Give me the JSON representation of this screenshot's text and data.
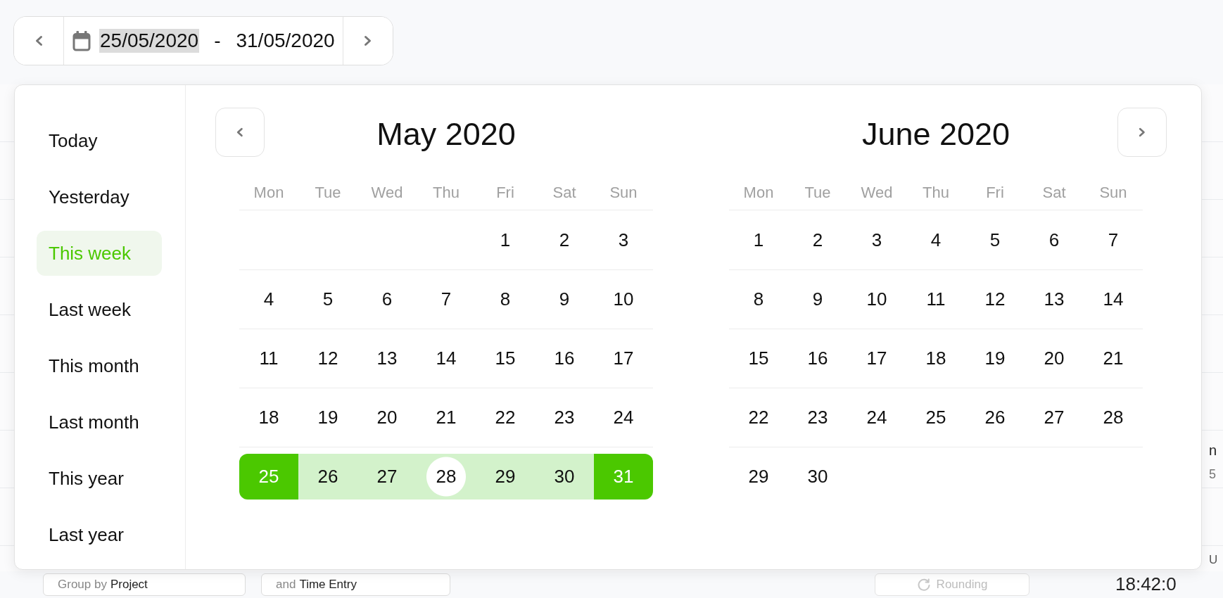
{
  "date_range": {
    "start": {
      "text": "25/05/2020",
      "highlighted": true
    },
    "separator": "-",
    "end": {
      "text": "31/05/2020",
      "highlighted": false
    }
  },
  "presets": [
    {
      "label": "Today",
      "selected": false
    },
    {
      "label": "Yesterday",
      "selected": false
    },
    {
      "label": "This week",
      "selected": true
    },
    {
      "label": "Last week",
      "selected": false
    },
    {
      "label": "This month",
      "selected": false
    },
    {
      "label": "Last month",
      "selected": false
    },
    {
      "label": "This year",
      "selected": false
    },
    {
      "label": "Last year",
      "selected": false
    }
  ],
  "months": [
    {
      "title": "May 2020",
      "weekdays": [
        "Mon",
        "Tue",
        "Wed",
        "Thu",
        "Fri",
        "Sat",
        "Sun"
      ],
      "weeks": [
        [
          {
            "kind": "blank"
          },
          {
            "kind": "blank"
          },
          {
            "kind": "blank"
          },
          {
            "kind": "blank"
          },
          {
            "kind": "plain",
            "day": "1",
            "today": false
          },
          {
            "kind": "plain",
            "day": "2",
            "today": false
          },
          {
            "kind": "plain",
            "day": "3",
            "today": false
          }
        ],
        [
          {
            "kind": "plain",
            "day": "4",
            "today": false
          },
          {
            "kind": "plain",
            "day": "5",
            "today": false
          },
          {
            "kind": "plain",
            "day": "6",
            "today": false
          },
          {
            "kind": "plain",
            "day": "7",
            "today": false
          },
          {
            "kind": "plain",
            "day": "8",
            "today": false
          },
          {
            "kind": "plain",
            "day": "9",
            "today": false
          },
          {
            "kind": "plain",
            "day": "10",
            "today": false
          }
        ],
        [
          {
            "kind": "plain",
            "day": "11",
            "today": false
          },
          {
            "kind": "plain",
            "day": "12",
            "today": false
          },
          {
            "kind": "plain",
            "day": "13",
            "today": false
          },
          {
            "kind": "plain",
            "day": "14",
            "today": false
          },
          {
            "kind": "plain",
            "day": "15",
            "today": false
          },
          {
            "kind": "plain",
            "day": "16",
            "today": false
          },
          {
            "kind": "plain",
            "day": "17",
            "today": false
          }
        ],
        [
          {
            "kind": "plain",
            "day": "18",
            "today": false
          },
          {
            "kind": "plain",
            "day": "19",
            "today": false
          },
          {
            "kind": "plain",
            "day": "20",
            "today": false
          },
          {
            "kind": "plain",
            "day": "21",
            "today": false
          },
          {
            "kind": "plain",
            "day": "22",
            "today": false
          },
          {
            "kind": "plain",
            "day": "23",
            "today": false
          },
          {
            "kind": "plain",
            "day": "24",
            "today": false
          }
        ],
        [
          {
            "kind": "range_start",
            "day": "25",
            "today": false
          },
          {
            "kind": "in_range",
            "day": "26",
            "today": false
          },
          {
            "kind": "in_range",
            "day": "27",
            "today": false
          },
          {
            "kind": "in_range",
            "day": "28",
            "today": true
          },
          {
            "kind": "in_range",
            "day": "29",
            "today": false
          },
          {
            "kind": "in_range",
            "day": "30",
            "today": false
          },
          {
            "kind": "range_end",
            "day": "31",
            "today": false
          }
        ]
      ]
    },
    {
      "title": "June 2020",
      "weekdays": [
        "Mon",
        "Tue",
        "Wed",
        "Thu",
        "Fri",
        "Sat",
        "Sun"
      ],
      "weeks": [
        [
          {
            "kind": "plain",
            "day": "1",
            "today": false
          },
          {
            "kind": "plain",
            "day": "2",
            "today": false
          },
          {
            "kind": "plain",
            "day": "3",
            "today": false
          },
          {
            "kind": "plain",
            "day": "4",
            "today": false
          },
          {
            "kind": "plain",
            "day": "5",
            "today": false
          },
          {
            "kind": "plain",
            "day": "6",
            "today": false
          },
          {
            "kind": "plain",
            "day": "7",
            "today": false
          }
        ],
        [
          {
            "kind": "plain",
            "day": "8",
            "today": false
          },
          {
            "kind": "plain",
            "day": "9",
            "today": false
          },
          {
            "kind": "plain",
            "day": "10",
            "today": false
          },
          {
            "kind": "plain",
            "day": "11",
            "today": false
          },
          {
            "kind": "plain",
            "day": "12",
            "today": false
          },
          {
            "kind": "plain",
            "day": "13",
            "today": false
          },
          {
            "kind": "plain",
            "day": "14",
            "today": false
          }
        ],
        [
          {
            "kind": "plain",
            "day": "15",
            "today": false
          },
          {
            "kind": "plain",
            "day": "16",
            "today": false
          },
          {
            "kind": "plain",
            "day": "17",
            "today": false
          },
          {
            "kind": "plain",
            "day": "18",
            "today": false
          },
          {
            "kind": "plain",
            "day": "19",
            "today": false
          },
          {
            "kind": "plain",
            "day": "20",
            "today": false
          },
          {
            "kind": "plain",
            "day": "21",
            "today": false
          }
        ],
        [
          {
            "kind": "plain",
            "day": "22",
            "today": false
          },
          {
            "kind": "plain",
            "day": "23",
            "today": false
          },
          {
            "kind": "plain",
            "day": "24",
            "today": false
          },
          {
            "kind": "plain",
            "day": "25",
            "today": false
          },
          {
            "kind": "plain",
            "day": "26",
            "today": false
          },
          {
            "kind": "plain",
            "day": "27",
            "today": false
          },
          {
            "kind": "plain",
            "day": "28",
            "today": false
          }
        ],
        [
          {
            "kind": "plain",
            "day": "29",
            "today": false
          },
          {
            "kind": "plain",
            "day": "30",
            "today": false
          }
        ]
      ]
    }
  ],
  "side_column": [
    {
      "kind": "heading",
      "text": "n"
    },
    {
      "kind": "value",
      "text": "5"
    },
    {
      "kind": "label",
      "text": "U"
    }
  ],
  "toolbar": {
    "dropdowns": [
      {
        "label": "Group by",
        "value": "Project"
      },
      {
        "label": "and",
        "value": "Time Entry"
      }
    ],
    "rounding": {
      "label": "Rounding",
      "disabled": true
    },
    "timer": "18:42:0"
  }
}
